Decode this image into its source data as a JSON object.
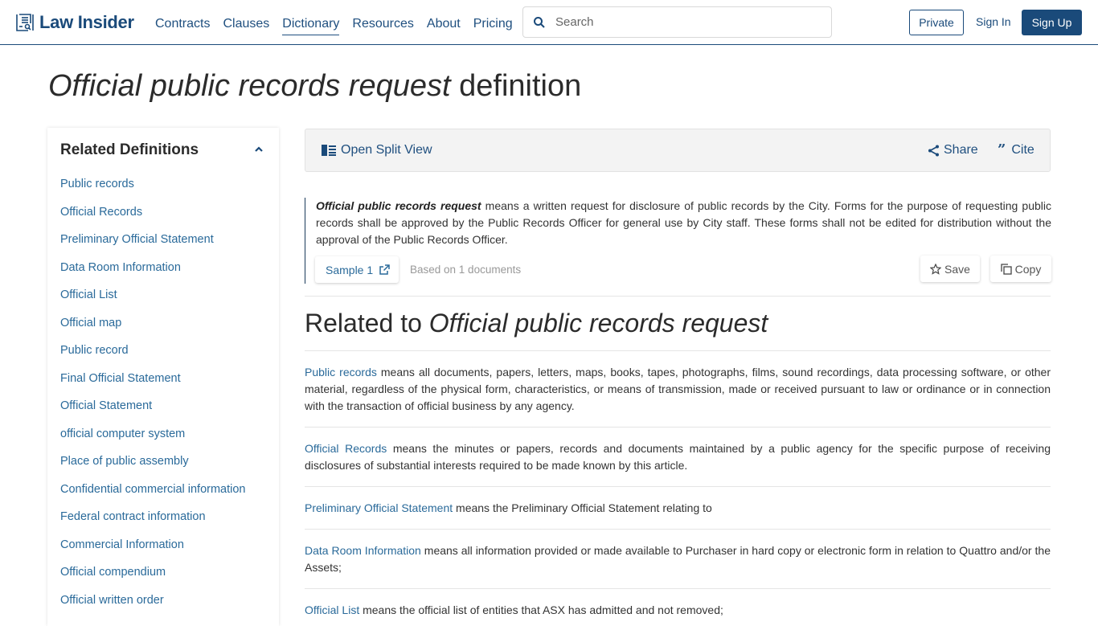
{
  "header": {
    "logo_text": "Law Insider",
    "nav": [
      "Contracts",
      "Clauses",
      "Dictionary",
      "Resources",
      "About",
      "Pricing"
    ],
    "active_nav": "Dictionary",
    "search_placeholder": "Search",
    "private_label": "Private",
    "signin_label": "Sign In",
    "signup_label": "Sign Up"
  },
  "page": {
    "title_term": "Official public records request",
    "title_suffix": "definition"
  },
  "sidebar": {
    "heading": "Related Definitions",
    "items": [
      "Public records",
      "Official Records",
      "Preliminary Official Statement",
      "Data Room Information",
      "Official List",
      "Official map",
      "Public record",
      "Final Official Statement",
      "Official Statement",
      "official computer system",
      "Place of public assembly",
      "Confidential commercial information",
      "Federal contract information",
      "Commercial Information",
      "Official compendium",
      "Official written order"
    ]
  },
  "toolbar": {
    "split_view_label": "Open Split View",
    "share_label": "Share",
    "cite_label": "Cite"
  },
  "definition": {
    "term": "Official public records request",
    "text": " means a written request for disclosure of public records by the City. Forms for the purpose of requesting public records shall be approved by the Public Records Officer for general use by City staff. These forms shall not be edited for distribution without the approval of the Public Records Officer.",
    "sample_label": "Sample 1",
    "based_on": "Based on 1 documents",
    "save_label": "Save",
    "copy_label": "Copy"
  },
  "related": {
    "heading_prefix": "Related to",
    "heading_term": "Official public records request",
    "items": [
      {
        "term": "Public records",
        "text": " means all documents, papers, letters, maps, books, tapes, photographs, films, sound recordings, data processing software, or other material, regardless of the physical form, characteristics, or means of transmission, made or received pursuant to law or ordinance or in connection with the transaction of official business by any agency."
      },
      {
        "term": "Official Records",
        "text": " means the minutes or papers, records and documents maintained by a public agency for the specific purpose of receiving disclosures of substantial interests required to be made known by this article."
      },
      {
        "term": "Preliminary Official Statement",
        "text": " means the Preliminary Official Statement relating to"
      },
      {
        "term": "Data Room Information",
        "text": " means all information provided or made available to Purchaser in hard copy or electronic form in relation to Quattro and/or the Assets;"
      },
      {
        "term": "Official List",
        "text": " means the official list of entities that ASX has admitted and not removed;"
      }
    ]
  },
  "colors": {
    "brand": "#1a4a7a",
    "link": "#2a6a9a"
  }
}
